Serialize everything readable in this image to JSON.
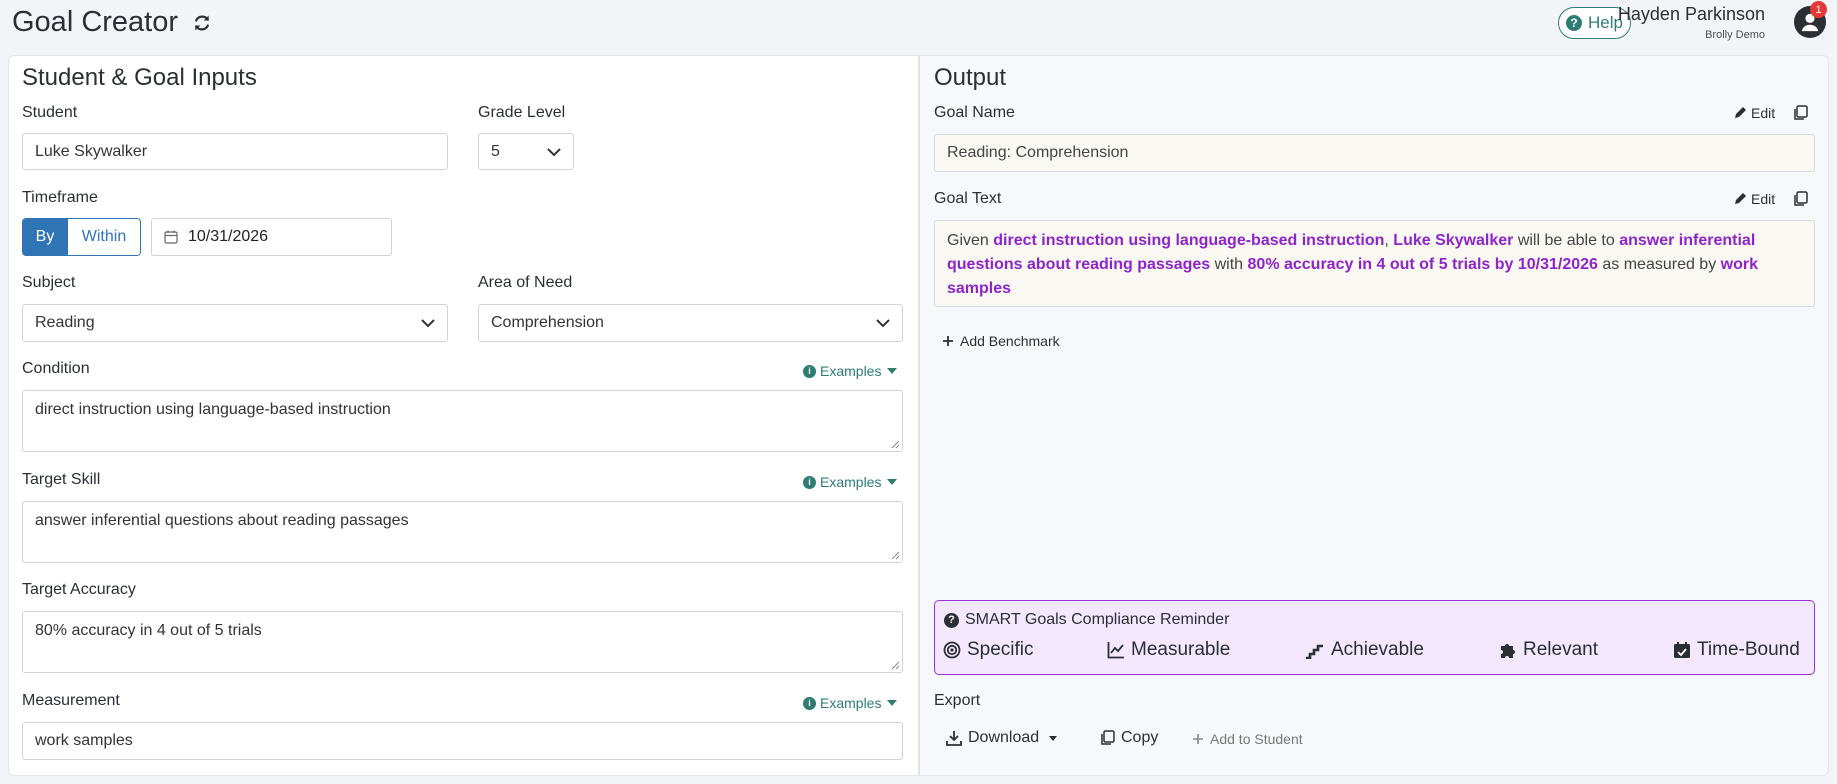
{
  "header": {
    "title": "Goal Creator",
    "help_label": "Help",
    "user_name": "Hayden Parkinson",
    "user_org": "Brolly Demo",
    "notification_count": "1"
  },
  "inputs": {
    "section_title": "Student & Goal Inputs",
    "student_label": "Student",
    "student_value": "Luke Skywalker",
    "grade_label": "Grade Level",
    "grade_value": "5",
    "timeframe_label": "Timeframe",
    "timeframe_by": "By",
    "timeframe_within": "Within",
    "date_value": "10/31/2026",
    "subject_label": "Subject",
    "subject_value": "Reading",
    "area_label": "Area of Need",
    "area_value": "Comprehension",
    "condition_label": "Condition",
    "condition_value": "direct instruction using language-based instruction",
    "target_skill_label": "Target Skill",
    "target_skill_value": "answer inferential questions about reading passages",
    "target_accuracy_label": "Target Accuracy",
    "target_accuracy_value": "80% accuracy in 4 out of 5 trials",
    "measurement_label": "Measurement",
    "measurement_value": "work samples",
    "examples_label": "Examples"
  },
  "output": {
    "section_title": "Output",
    "goal_name_label": "Goal Name",
    "goal_name_value": "Reading: Comprehension",
    "goal_text_label": "Goal Text",
    "edit_label": "Edit",
    "goal_text": {
      "p1": "Given ",
      "h1": "direct instruction using language-based instruction",
      "p2": ", ",
      "h2": "Luke Skywalker",
      "p3": " will be able to ",
      "h3": "answer inferential questions about reading passages",
      "p4": " with ",
      "h4": "80% accuracy in 4 out of 5 trials by 10/31/2026",
      "p5": " as measured by ",
      "h5": "work samples"
    },
    "add_benchmark_label": "Add Benchmark"
  },
  "smart": {
    "title": "SMART Goals Compliance Reminder",
    "items": [
      "Specific",
      "Measurable",
      "Achievable",
      "Relevant",
      "Time-Bound"
    ]
  },
  "export": {
    "label": "Export",
    "download_label": "Download",
    "copy_label": "Copy",
    "add_to_student_label": "Add to Student"
  },
  "colors": {
    "accent_teal": "#2e7d73",
    "accent_blue": "#2f74b5",
    "highlight_purple": "#8e24c9"
  }
}
